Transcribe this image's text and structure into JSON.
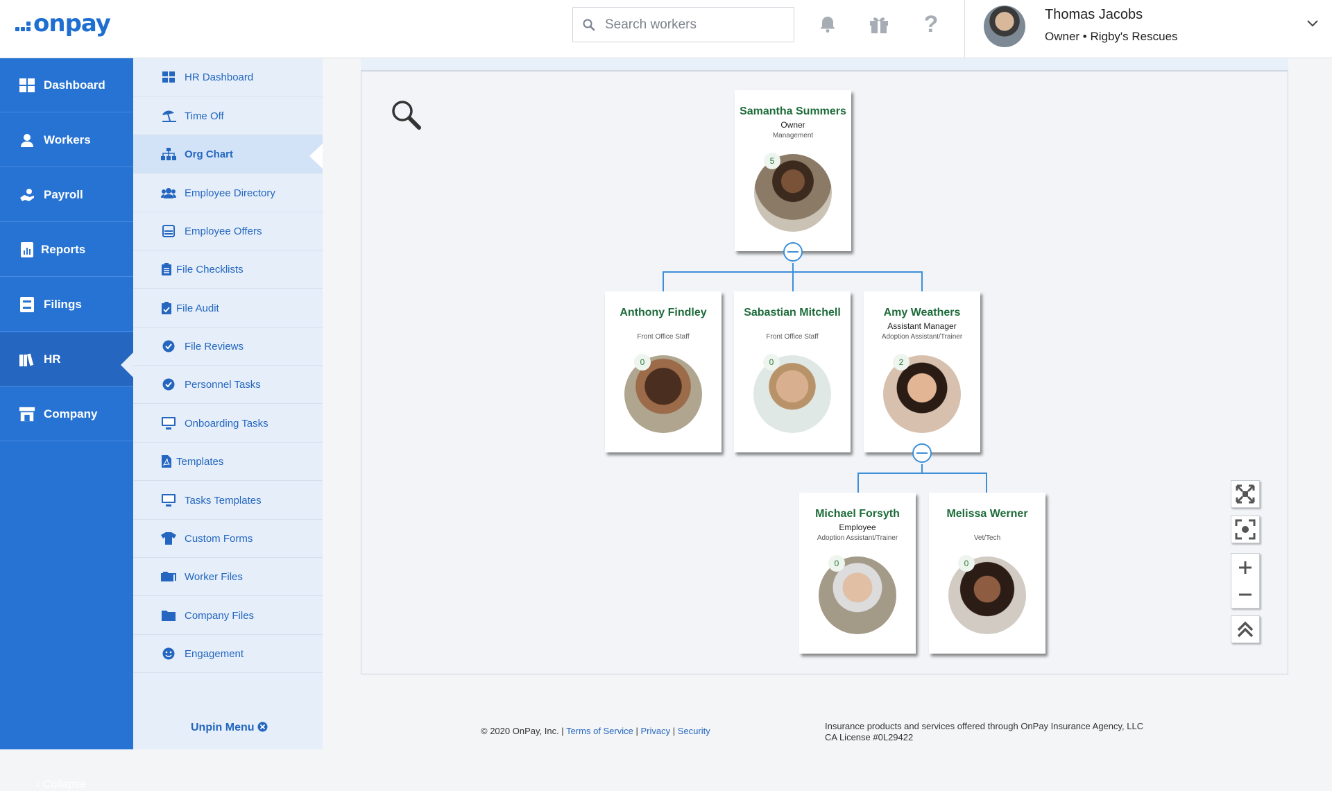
{
  "header": {
    "logo_text": "onpay",
    "search_placeholder": "Search workers",
    "user_name": "Thomas Jacobs",
    "user_role": "Owner • Rigby's Rescues"
  },
  "sidebar": {
    "items": [
      {
        "label": "Dashboard"
      },
      {
        "label": "Workers"
      },
      {
        "label": "Payroll"
      },
      {
        "label": "Reports"
      },
      {
        "label": "Filings"
      },
      {
        "label": "HR"
      },
      {
        "label": "Company"
      }
    ],
    "collapse_label": "‹ Collapse"
  },
  "submenu": {
    "items": [
      {
        "label": "HR Dashboard"
      },
      {
        "label": "Time Off"
      },
      {
        "label": "Org Chart"
      },
      {
        "label": "Employee Directory"
      },
      {
        "label": "Employee Offers"
      },
      {
        "label": "File Checklists"
      },
      {
        "label": "File Audit"
      },
      {
        "label": "File Reviews"
      },
      {
        "label": "Personnel Tasks"
      },
      {
        "label": "Onboarding Tasks"
      },
      {
        "label": "Templates"
      },
      {
        "label": "Tasks Templates"
      },
      {
        "label": "Custom Forms"
      },
      {
        "label": "Worker Files"
      },
      {
        "label": "Company Files"
      },
      {
        "label": "Engagement"
      }
    ],
    "unpin_label": "Unpin Menu"
  },
  "org_chart": {
    "people": [
      {
        "name": "Samantha Summers",
        "title": "Owner",
        "dept": "Management",
        "reports": "5"
      },
      {
        "name": "Anthony Findley",
        "title": "",
        "dept": "Front Office Staff",
        "reports": "0"
      },
      {
        "name": "Sabastian Mitchell",
        "title": "",
        "dept": "Front Office Staff",
        "reports": "0"
      },
      {
        "name": "Amy Weathers",
        "title": "Assistant Manager",
        "dept": "Adoption Assistant/Trainer",
        "reports": "2"
      },
      {
        "name": "Michael Forsyth",
        "title": "Employee",
        "dept": "Adoption Assistant/Trainer",
        "reports": "0"
      },
      {
        "name": "Melissa Werner",
        "title": "",
        "dept": "Vet/Tech",
        "reports": "0"
      }
    ]
  },
  "footer": {
    "copyright": "© 2020 OnPay, Inc. |",
    "terms": "Terms of Service",
    "sep1": "|",
    "privacy": "Privacy",
    "sep2": "|",
    "security": "Security",
    "insurance": "Insurance products and services offered through OnPay Insurance Agency, LLC",
    "license": "CA License #0L29422"
  },
  "colors": {
    "brand_blue": "#2673d3",
    "name_green": "#1d6b3a",
    "connector_blue": "#3d8fd8"
  }
}
